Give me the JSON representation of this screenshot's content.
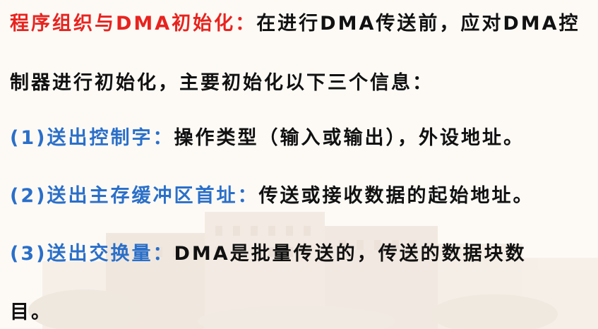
{
  "slide": {
    "line1": {
      "heading": "程序组织与DMA初始化：",
      "text": "在进行DMA传送前，应对DMA控"
    },
    "line2": {
      "text": "制器进行初始化，主要初始化以下三个信息："
    },
    "item1": {
      "label": "(1)送出控制字：",
      "text": "操作类型（输入或输出），外设地址。"
    },
    "item2": {
      "label": "(2)送出主存缓冲区首址：",
      "text": "传送或接收数据的起始地址。"
    },
    "item3": {
      "label": "(3)送出交换量：",
      "text": "DMA是批量传送的，传送的数据块数"
    },
    "line6": {
      "text": "目。"
    }
  }
}
